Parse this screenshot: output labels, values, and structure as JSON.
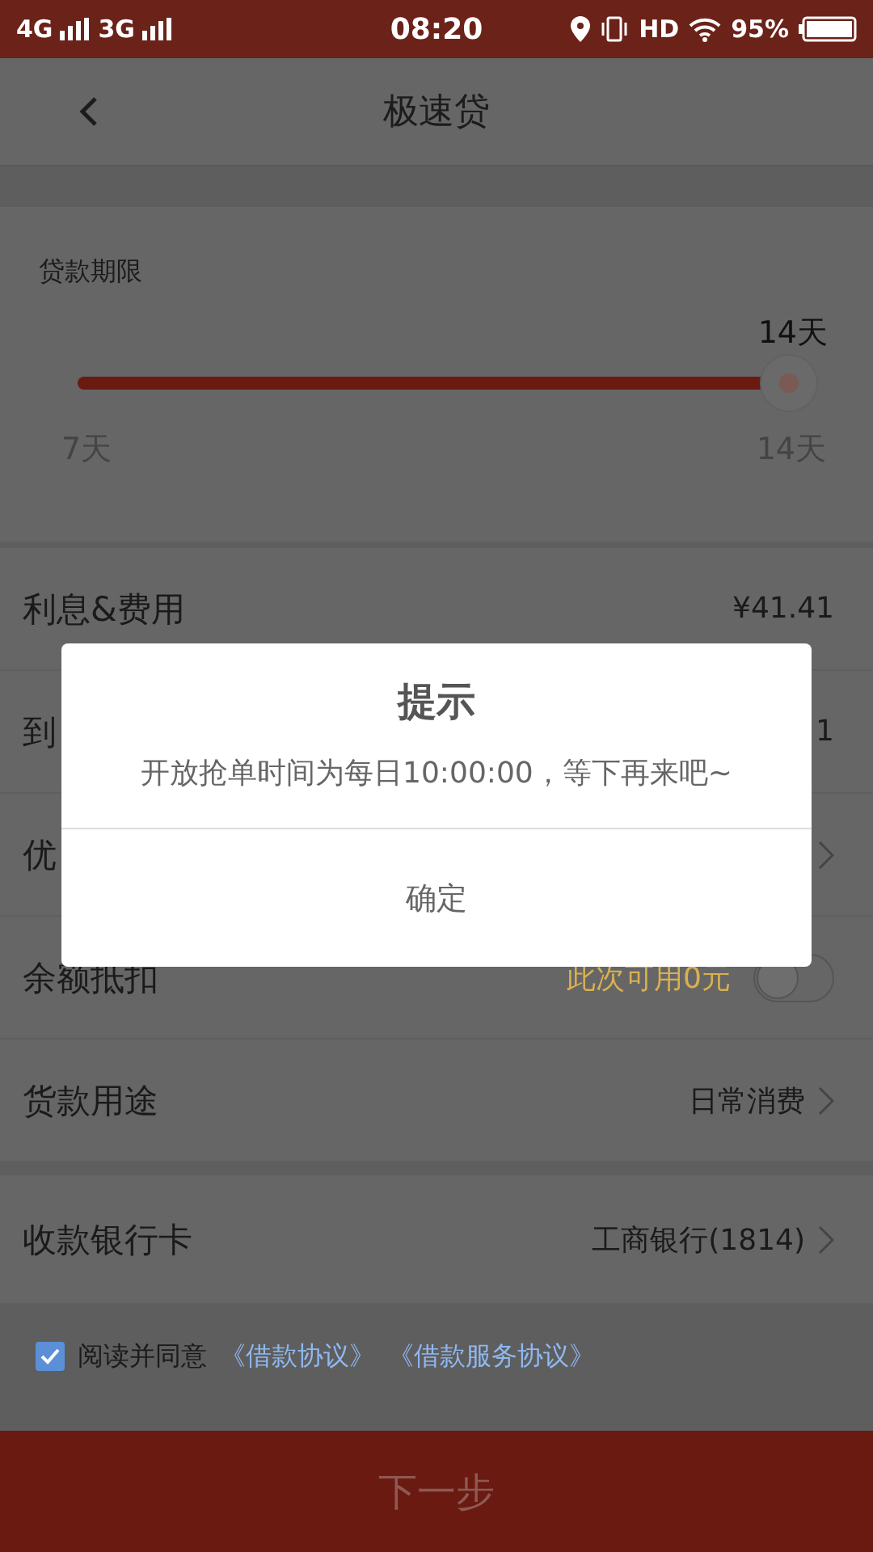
{
  "status_bar": {
    "network_1": "4G",
    "network_2": "3G",
    "time": "08:20",
    "hd": "HD",
    "battery": "95%"
  },
  "header": {
    "title": "极速贷"
  },
  "term": {
    "label": "贷款期限",
    "value": "14天",
    "level": 1,
    "min": "7天",
    "max": "14天"
  },
  "rows": [
    {
      "kind": "value",
      "label": "利息&费用",
      "value": "¥41.41"
    },
    {
      "kind": "value",
      "label": "到",
      "value": "1"
    },
    {
      "kind": "link",
      "label": "优"
    },
    {
      "kind": "toggle",
      "label": "余额抵扣",
      "value": "此次可用0元",
      "on": false
    },
    {
      "kind": "link",
      "label": "货款用途",
      "value": "日常消费"
    }
  ],
  "bank": {
    "label": "收款银行卡",
    "value": "工商银行(1814)"
  },
  "agreement": {
    "checked": true,
    "text": "阅读并同意",
    "links": [
      "《借款协议》",
      "《借款服务协议》"
    ]
  },
  "dialog": {
    "title": "提示",
    "message": "开放抢单时间为每日10:00:00，等下再来吧~",
    "button": "确定"
  },
  "next_button": "下一步"
}
